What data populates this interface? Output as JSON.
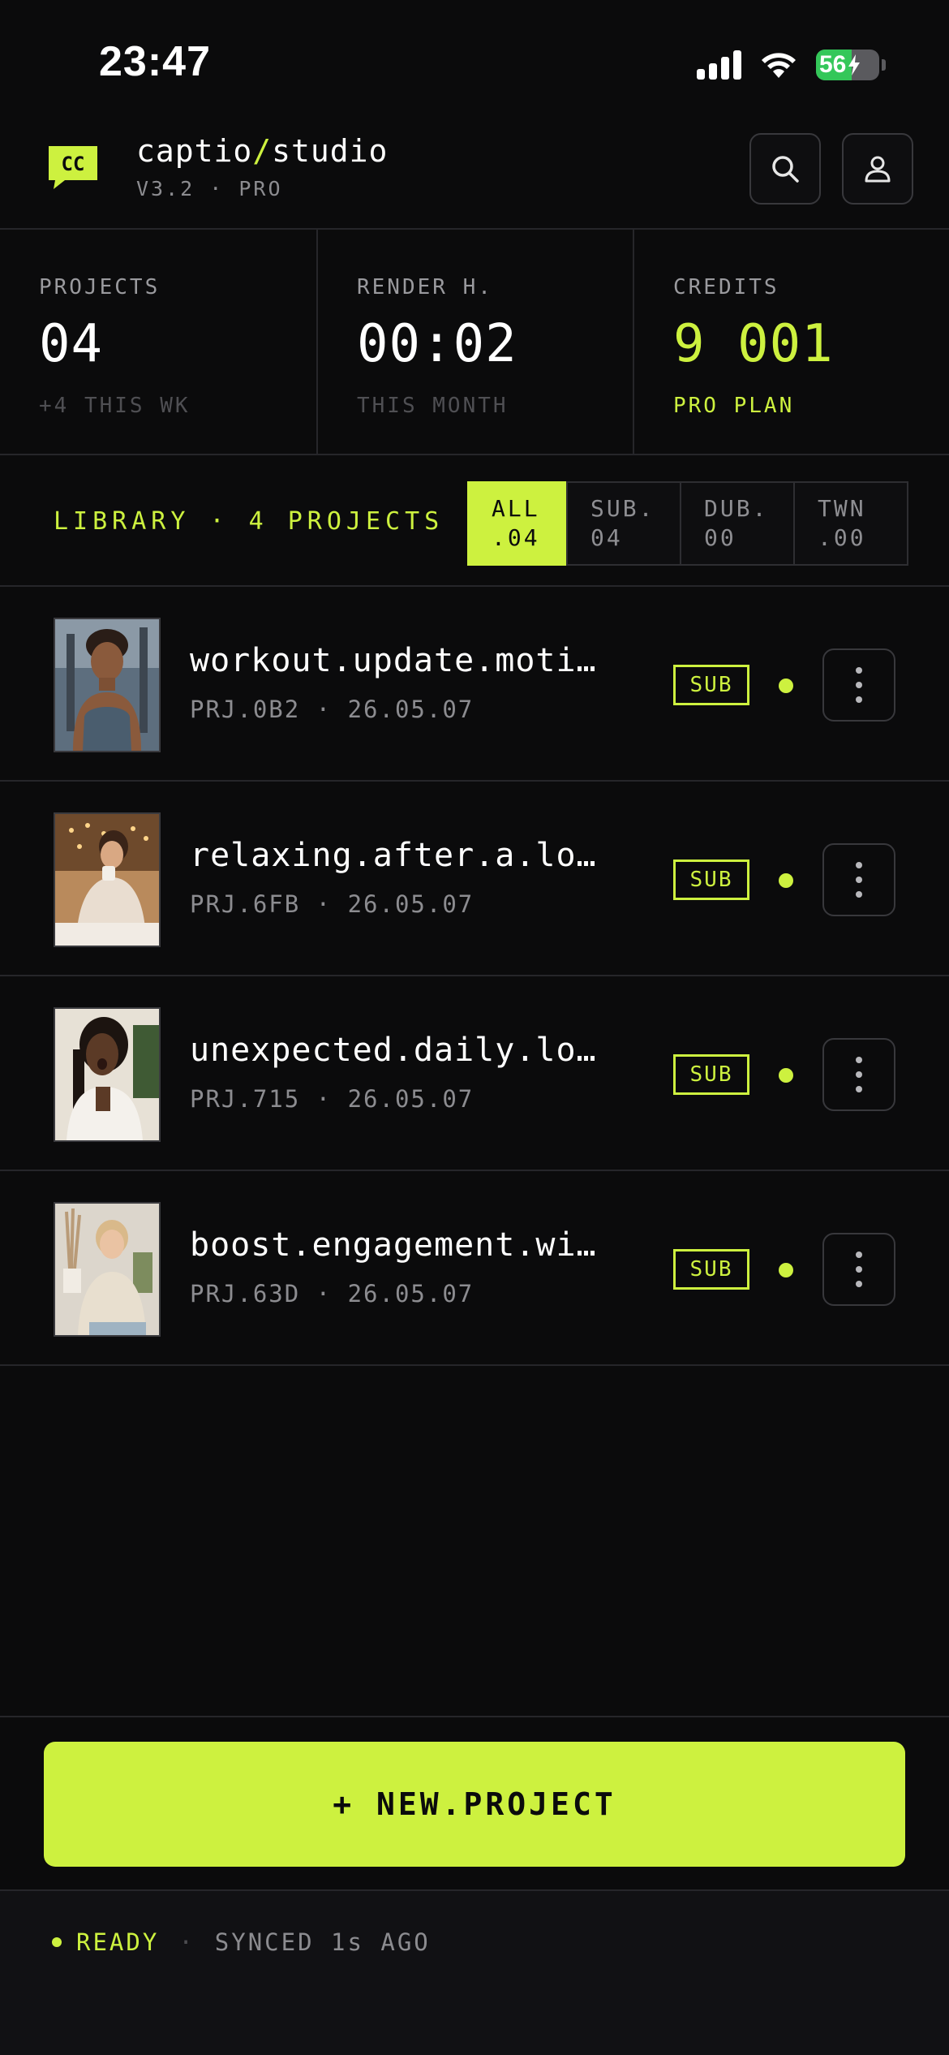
{
  "status_bar": {
    "time": "23:47",
    "battery": "56"
  },
  "header": {
    "brand_first": "captio",
    "brand_slash": "/",
    "brand_second": "studio",
    "version": "V3.2 · PRO",
    "icons": [
      "cc-logo-icon",
      "search-icon",
      "profile-icon"
    ]
  },
  "stats": [
    {
      "label": "PROJECTS",
      "value": "04",
      "sub": "+4 THIS WK"
    },
    {
      "label": "RENDER H.",
      "value": "00:02",
      "sub": "THIS MONTH"
    },
    {
      "label": "CREDITS",
      "value": "9 001",
      "sub": "PRO PLAN"
    }
  ],
  "library": {
    "title": "LIBRARY · 4 PROJECTS",
    "filters": [
      {
        "label": "ALL",
        "count": ".04"
      },
      {
        "label": "SUB.",
        "count": "04"
      },
      {
        "label": "DUB.",
        "count": "00"
      },
      {
        "label": "TWN",
        "count": ".00"
      }
    ]
  },
  "projects": [
    {
      "name": "workout.update.moti…",
      "meta": "PRJ.0B2 · 26.05.07",
      "badge": "SUB"
    },
    {
      "name": "relaxing.after.a.lo…",
      "meta": "PRJ.6FB · 26.05.07",
      "badge": "SUB"
    },
    {
      "name": "unexpected.daily.lo…",
      "meta": "PRJ.715 · 26.05.07",
      "badge": "SUB"
    },
    {
      "name": "boost.engagement.wi…",
      "meta": "PRJ.63D · 26.05.07",
      "badge": "SUB"
    }
  ],
  "cta": {
    "label": "+ NEW.PROJECT"
  },
  "footer": {
    "status": "READY",
    "separator": "·",
    "synced": "SYNCED 1s AGO"
  },
  "colors": {
    "accent": "#cdf13f",
    "background": "#0b0b0c",
    "battery": "#34c759"
  }
}
